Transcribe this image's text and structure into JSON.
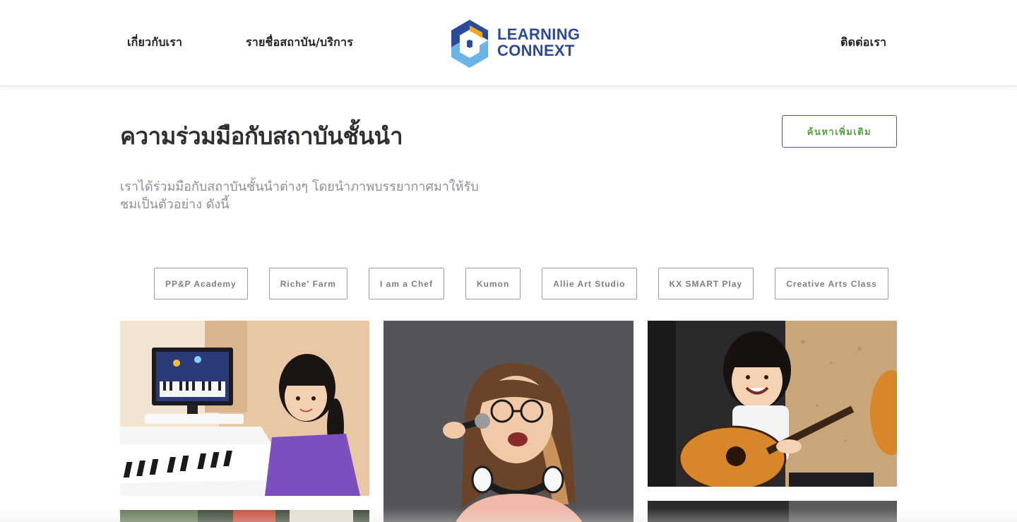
{
  "nav": {
    "about": "เกี่ยวกับเรา",
    "institutions": "รายชื่อสถาบัน/บริการ",
    "contact": "ติดต่อเรา"
  },
  "logo": {
    "line1": "LEARNING",
    "line2": "CONNEXT",
    "colors": {
      "blue": "#2a4a9a",
      "light_blue": "#6ab4e8",
      "orange": "#f0a81e"
    }
  },
  "section": {
    "title": "ความร่วมมือกับสถาบันชั้นนำ",
    "more_button": "ค้นหาเพิ่มเติม",
    "description": "เราได้ร่วมมือกับสถาบันชั้นนำต่างๆ โดยนำภาพบรรยากาศมาให้รับชมเป็นตัวอย่าง ดังนี้"
  },
  "filters": [
    "PP&P Academy",
    "Riche' Farm",
    "I am a Chef",
    "Kumon",
    "Allie Art Studio",
    "KX SMART Play",
    "Creative Arts Class"
  ],
  "gallery": [
    {
      "subject": "girl-playing-piano-photo"
    },
    {
      "subject": "woman-singing-microphone-photo"
    },
    {
      "subject": "girl-playing-guitar-photo"
    },
    {
      "subject": "classroom-photo"
    },
    {
      "subject": "studio-photo"
    }
  ],
  "colors": {
    "button_border": "#5b4a9e",
    "button_text": "#54a33d",
    "title_text": "#2e2e33",
    "desc_text": "#8b8f9c"
  }
}
